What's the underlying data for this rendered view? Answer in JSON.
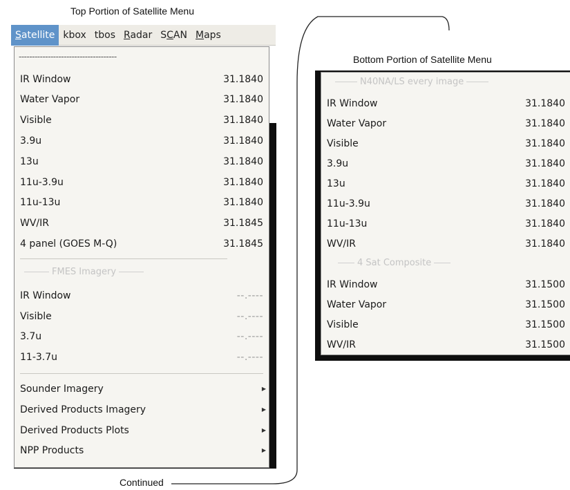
{
  "captions": {
    "top": "Top Portion of Satellite Menu",
    "bottom": "Bottom Portion of Satellite Menu",
    "continued": "Continued"
  },
  "menubar": [
    {
      "label": "Satellite",
      "mnemonic": "S",
      "rest": "atellite",
      "active": true
    },
    {
      "label": "kbox"
    },
    {
      "label": "tbos"
    },
    {
      "label": "Radar",
      "mnemonic": "R",
      "rest": "adar"
    },
    {
      "label": "SCAN",
      "pre": "S",
      "mnemonic": "C",
      "rest": "AN"
    },
    {
      "label": "Maps",
      "mnemonic": "M",
      "rest": "aps"
    }
  ],
  "top_menu": {
    "tearoff": "-------------------------------------",
    "goes_items": [
      {
        "label": "IR Window",
        "value": "31.1840"
      },
      {
        "label": "Water Vapor",
        "value": "31.1840"
      },
      {
        "label": "Visible",
        "value": "31.1840"
      },
      {
        "label": "3.9u",
        "value": "31.1840"
      },
      {
        "label": "13u",
        "value": "31.1840"
      },
      {
        "label": "11u-3.9u",
        "value": "31.1840"
      },
      {
        "label": "11u-13u",
        "value": "31.1840"
      },
      {
        "label": "WV/IR",
        "value": "31.1845"
      },
      {
        "label": "4 panel (GOES M-Q)",
        "value": "31.1845"
      }
    ],
    "fmes_title": "FMES Imagery",
    "fmes_items": [
      {
        "label": "IR Window",
        "value": "--.----"
      },
      {
        "label": "Visible",
        "value": "--.----"
      },
      {
        "label": "3.7u",
        "value": "--.----"
      },
      {
        "label": "11-3.7u",
        "value": "--.----"
      }
    ],
    "submenus": [
      {
        "label": "Sounder Imagery",
        "arrow": "▶"
      },
      {
        "label": "Derived Products Imagery",
        "arrow": "▶"
      },
      {
        "label": "Derived Products Plots",
        "arrow": "▶"
      },
      {
        "label": "NPP Products",
        "arrow": "▶"
      }
    ]
  },
  "bottom_menu": {
    "header_title": "N40NA/LS every image",
    "items_a": [
      {
        "label": "IR Window",
        "value": "31.1840"
      },
      {
        "label": "Water Vapor",
        "value": "31.1840"
      },
      {
        "label": "Visible",
        "value": "31.1840"
      },
      {
        "label": "3.9u",
        "value": "31.1840"
      },
      {
        "label": "13u",
        "value": "31.1840"
      },
      {
        "label": "11u-3.9u",
        "value": "31.1840"
      },
      {
        "label": "11u-13u",
        "value": "31.1840"
      },
      {
        "label": "WV/IR",
        "value": "31.1840"
      }
    ],
    "composite_title": "4 Sat Composite",
    "items_b": [
      {
        "label": "IR Window",
        "value": "31.1500"
      },
      {
        "label": "Water Vapor",
        "value": "31.1500"
      },
      {
        "label": "Visible",
        "value": "31.1500"
      },
      {
        "label": "WV/IR",
        "value": "31.1500"
      }
    ]
  }
}
